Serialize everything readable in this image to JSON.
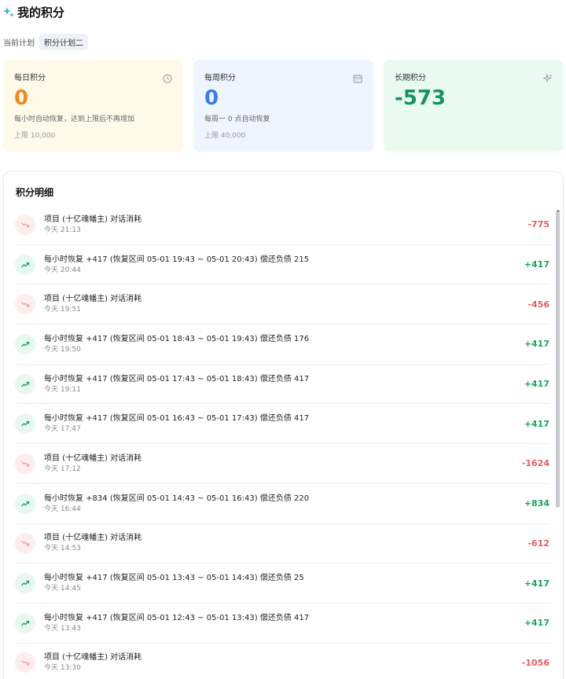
{
  "header": {
    "title": "我的积分"
  },
  "plan": {
    "label": "当前计划",
    "current": "积分计划二"
  },
  "cards": {
    "daily": {
      "title": "每日积分",
      "value": "0",
      "desc": "每小时自动恢复，达到上限后不再增加",
      "limit": "上限 10,000",
      "icon": "clock-icon",
      "accent": "#f08a24"
    },
    "weekly": {
      "title": "每周积分",
      "value": "0",
      "desc": "每周一 0 点自动恢复",
      "limit": "上限 40,000",
      "icon": "calendar-icon",
      "accent": "#3b7de9"
    },
    "long_term": {
      "title": "长期积分",
      "value": "-573",
      "icon": "sparkle-icon",
      "accent": "#16935f"
    }
  },
  "detail": {
    "title": "积分明细",
    "rows": [
      {
        "type": "down",
        "desc": "项目 (十亿魂幡主) 对话消耗",
        "time": "今天 21:13",
        "amount": "-775"
      },
      {
        "type": "up",
        "desc": "每小时恢复 +417 (恢复区间 05-01 19:43 ~ 05-01 20:43) 偿还负债 215",
        "time": "今天 20:44",
        "amount": "+417"
      },
      {
        "type": "down",
        "desc": "项目 (十亿魂幡主) 对话消耗",
        "time": "今天 19:51",
        "amount": "-456"
      },
      {
        "type": "up",
        "desc": "每小时恢复 +417 (恢复区间 05-01 18:43 ~ 05-01 19:43) 偿还负债 176",
        "time": "今天 19:50",
        "amount": "+417"
      },
      {
        "type": "up",
        "desc": "每小时恢复 +417 (恢复区间 05-01 17:43 ~ 05-01 18:43) 偿还负债 417",
        "time": "今天 19:11",
        "amount": "+417"
      },
      {
        "type": "up",
        "desc": "每小时恢复 +417 (恢复区间 05-01 16:43 ~ 05-01 17:43) 偿还负债 417",
        "time": "今天 17:47",
        "amount": "+417"
      },
      {
        "type": "down",
        "desc": "项目 (十亿魂幡主) 对话消耗",
        "time": "今天 17:12",
        "amount": "-1624"
      },
      {
        "type": "up",
        "desc": "每小时恢复 +834 (恢复区间 05-01 14:43 ~ 05-01 16:43) 偿还负债 220",
        "time": "今天 16:44",
        "amount": "+834"
      },
      {
        "type": "down",
        "desc": "项目 (十亿魂幡主) 对话消耗",
        "time": "今天 14:53",
        "amount": "-612"
      },
      {
        "type": "up",
        "desc": "每小时恢复 +417 (恢复区间 05-01 13:43 ~ 05-01 14:43) 偿还负债 25",
        "time": "今天 14:45",
        "amount": "+417"
      },
      {
        "type": "up",
        "desc": "每小时恢复 +417 (恢复区间 05-01 12:43 ~ 05-01 13:43) 偿还负债 417",
        "time": "今天 13:43",
        "amount": "+417"
      },
      {
        "type": "down",
        "desc": "项目 (十亿魂幡主) 对话消耗",
        "time": "今天 13:30",
        "amount": "-1056"
      }
    ]
  },
  "colors": {
    "positive": "#1aa263",
    "negative": "#ec5a5a"
  }
}
